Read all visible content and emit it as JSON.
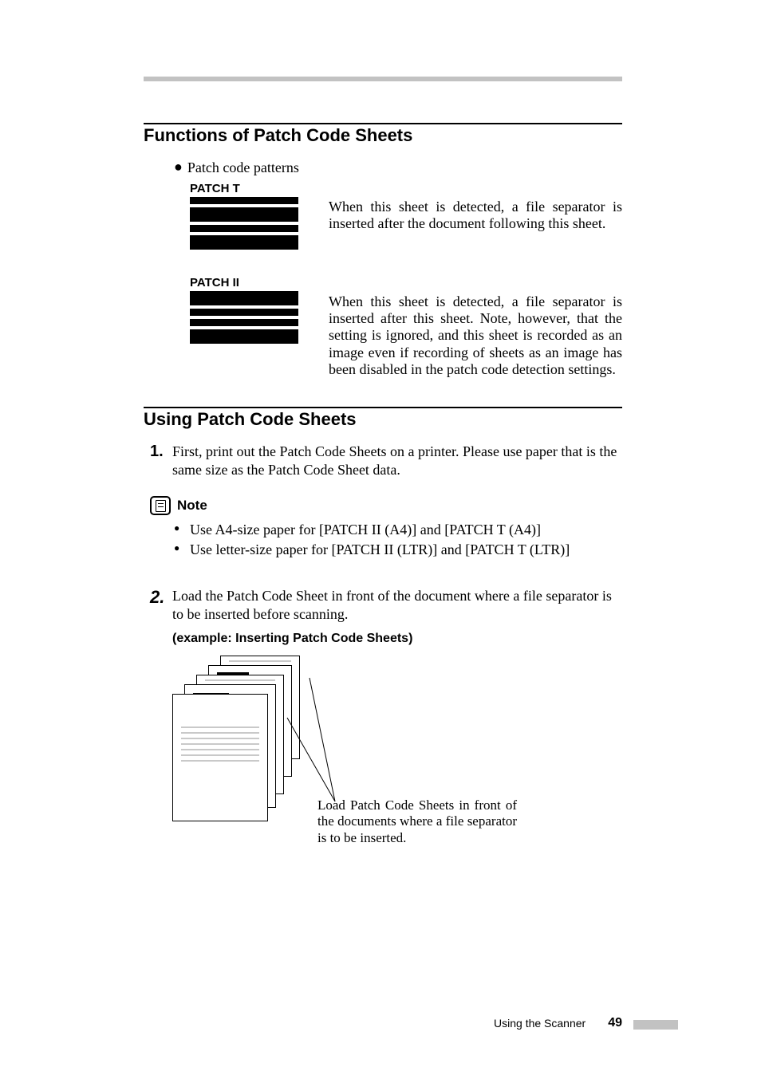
{
  "section1": {
    "title": "Functions of Patch Code Sheets",
    "bullet": "Patch code patterns",
    "patch_t_label": "PATCH T",
    "patch_t_desc": "When this sheet is detected, a file separator is inserted after the document following this sheet.",
    "patch_ii_label": "PATCH II",
    "patch_ii_desc": "When this sheet is detected, a file separator is inserted after this sheet. Note, however, that the setting is ignored, and this sheet is recorded as an image even if recording of sheets as an image has been disabled in the patch code detection settings."
  },
  "section2": {
    "title": "Using Patch Code Sheets",
    "step1_num": "1.",
    "step1_text": "First, print out the Patch Code Sheets on a printer.  Please use paper that is the same size as the Patch Code Sheet data.",
    "note_word": "Note",
    "note_item1": "Use A4-size paper for [PATCH II (A4)] and [PATCH T (A4)]",
    "note_item2": "Use letter-size paper for [PATCH II (LTR)] and [PATCH T (LTR)]",
    "step2_num": "2.",
    "step2_text": "Load the Patch Code Sheet in front of the document where a file separator is to be inserted before scanning.",
    "example_title": "(example: Inserting Patch Code Sheets)",
    "diagram_caption": "Load Patch Code Sheets in front of the documents where a file separator is to be inserted."
  },
  "footer": {
    "text": "Using the Scanner",
    "page": "49"
  }
}
